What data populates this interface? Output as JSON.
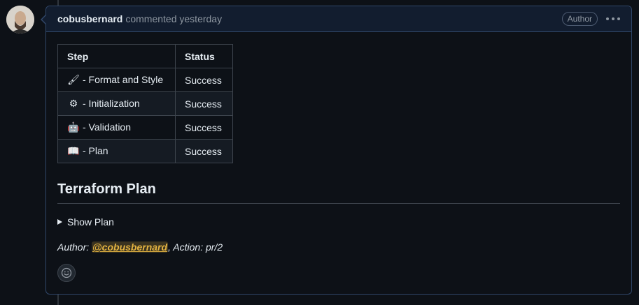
{
  "comment": {
    "author": "cobusbernard",
    "meta": "commented yesterday",
    "badge": "Author",
    "more_icon": "kebab-horizontal-icon"
  },
  "table": {
    "headers": [
      "Step",
      "Status"
    ],
    "rows": [
      {
        "icon": "paintbrush-icon",
        "glyph": "🖌",
        "step": "- Format and Style",
        "status": "Success"
      },
      {
        "icon": "gear-icon",
        "glyph": "⚙",
        "step": "- Initialization",
        "status": "Success"
      },
      {
        "icon": "robot-icon",
        "glyph": "🤖",
        "step": "- Validation",
        "status": "Success"
      },
      {
        "icon": "book-icon",
        "glyph": "📖",
        "step": "- Plan",
        "status": "Success"
      }
    ]
  },
  "plan": {
    "title": "Terraform Plan",
    "details_summary": "Show Plan"
  },
  "footer": {
    "author_label": "Author: ",
    "mention": "@cobusbernard",
    "action_text": ", Action: pr/2"
  },
  "reaction": {
    "icon": "smiley-icon"
  },
  "colors": {
    "background": "#0d1117",
    "header_bg": "#121d2f",
    "border": "#30476a",
    "mention": "#e3b341"
  }
}
